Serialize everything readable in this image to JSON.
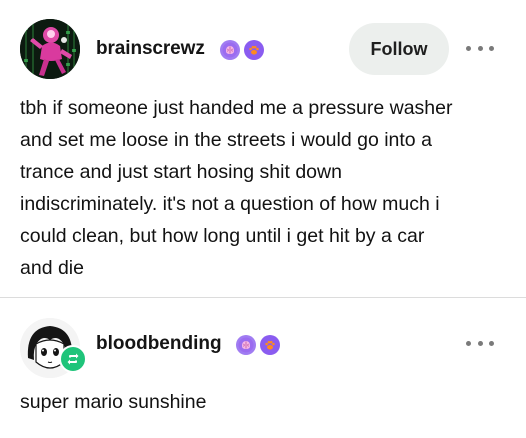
{
  "post": {
    "username": "brainscrewz",
    "follow_label": "Follow",
    "body": "tbh if someone just handed me a pressure washer\nand set me loose in the streets i would go into a\ntrance and just start hosing shit down\nindiscriminately. it's not a question of how much i\ncould clean, but how long until i get hit by a car\nand die",
    "avatar_icon": "pink-character-avatar",
    "badges": [
      "brain-badge-icon",
      "paw-badge-icon"
    ]
  },
  "reblog": {
    "username": "bloodbending",
    "body": "super mario sunshine",
    "avatar_icon": "anime-girl-avatar",
    "badges": [
      "brain-badge-icon",
      "paw-badge-icon"
    ]
  },
  "colors": {
    "follow_bg": "#ecefed",
    "reblog_green": "#1fc47a",
    "divider": "#dcdcdc",
    "brain_badge": "#9b6cf0",
    "paw_badge": "#8a5cf0"
  }
}
